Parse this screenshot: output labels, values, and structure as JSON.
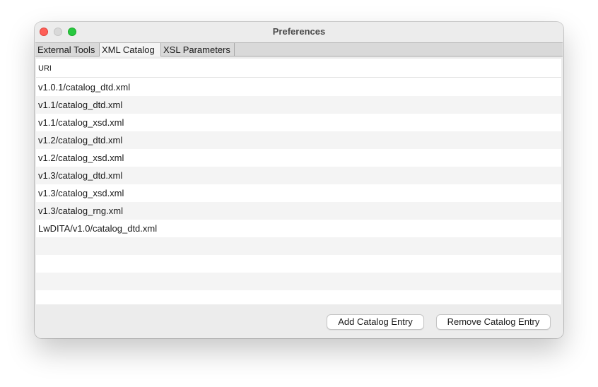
{
  "window": {
    "title": "Preferences"
  },
  "tabs": [
    {
      "label": "External Tools",
      "selected": false
    },
    {
      "label": "XML Catalog",
      "selected": true
    },
    {
      "label": "XSL Parameters",
      "selected": false
    }
  ],
  "table": {
    "column_header": "URI",
    "rows": [
      "v1.0.1/catalog_dtd.xml",
      "v1.1/catalog_dtd.xml",
      "v1.1/catalog_xsd.xml",
      "v1.2/catalog_dtd.xml",
      "v1.2/catalog_xsd.xml",
      "v1.3/catalog_dtd.xml",
      "v1.3/catalog_xsd.xml",
      "v1.3/catalog_rng.xml",
      "LwDITA/v1.0/catalog_dtd.xml",
      "",
      "",
      "",
      ""
    ]
  },
  "buttons": {
    "add": "Add Catalog Entry",
    "remove": "Remove Catalog Entry"
  },
  "colors": {
    "close": "#fe5f57",
    "minimize_disabled": "#d9d9d9",
    "zoom": "#28c840",
    "row_stripe": "#f4f4f4"
  }
}
